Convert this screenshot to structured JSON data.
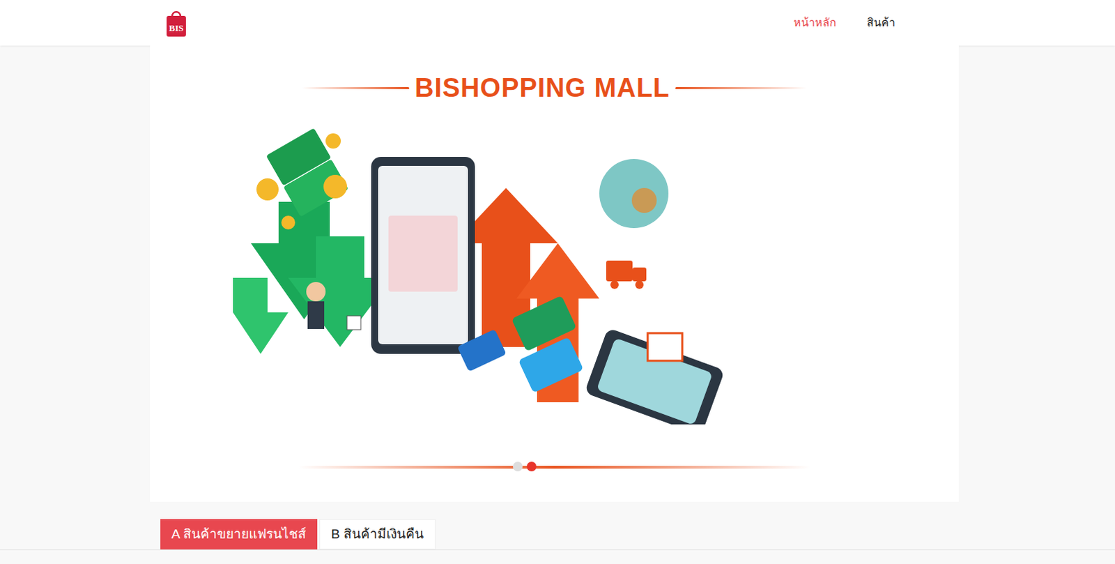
{
  "logo": {
    "text": "BIS"
  },
  "nav": [
    {
      "label": "หน้าหลัก",
      "selected": true
    },
    {
      "label": "สินค้า",
      "selected": false
    }
  ],
  "banner": {
    "title": "BISHOPPING MALL",
    "slides": [
      {
        "selected": false
      },
      {
        "selected": true
      }
    ]
  },
  "tabs": [
    {
      "label": "A สินค้าขยายแฟรนไชส์",
      "selected": true
    },
    {
      "label": "B สินค้ามีเงินคืน",
      "selected": false
    }
  ]
}
